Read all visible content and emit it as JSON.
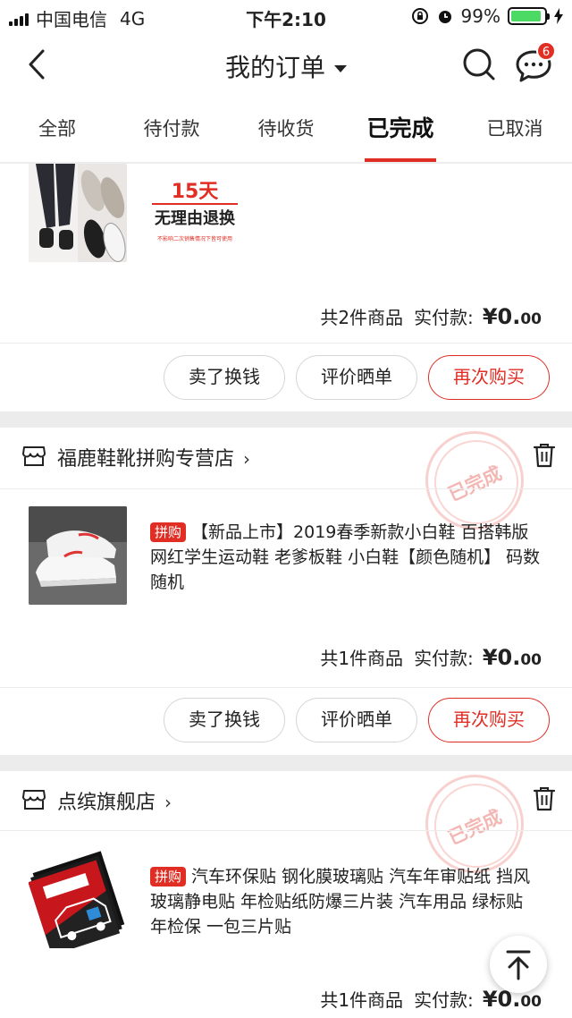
{
  "status_bar": {
    "carrier": "中国电信",
    "network": "4G",
    "time": "下午2:10",
    "battery": "99%"
  },
  "nav": {
    "title": "我的订单",
    "message_badge": "6"
  },
  "tabs": [
    {
      "label": "全部"
    },
    {
      "label": "待付款"
    },
    {
      "label": "待收货"
    },
    {
      "label": "已完成"
    },
    {
      "label": "已取消"
    }
  ],
  "orders": [
    {
      "promo_days": "15天",
      "promo_main": "无理由退换",
      "promo_small": "不影响二次销售情况下皆可使用",
      "count_text": "共2件商品",
      "pay_label": "实付款:",
      "price_int": "¥0.",
      "price_dec": "00",
      "buttons": [
        "卖了换钱",
        "评价晒单",
        "再次购买"
      ]
    },
    {
      "store": "福鹿鞋靴拼购专营店",
      "stamp": "已完成",
      "tag": "拼购",
      "title": "【新品上市】2019春季新款小白鞋 百搭韩版网红学生运动鞋 老爹板鞋 小白鞋【颜色随机】 码数随机",
      "count_text": "共1件商品",
      "pay_label": "实付款:",
      "price_int": "¥0.",
      "price_dec": "00",
      "buttons": [
        "卖了换钱",
        "评价晒单",
        "再次购买"
      ]
    },
    {
      "store": "点缤旗舰店",
      "stamp": "已完成",
      "tag": "拼购",
      "title": "汽车环保贴 钢化膜玻璃贴 汽车年审贴纸 挡风玻璃静电贴 年检贴纸防爆三片装 汽车用品 绿标贴 年检保 一包三片贴",
      "count_text": "共1件商品",
      "pay_label": "实付款:",
      "price_int": "¥0.",
      "price_dec": "00"
    }
  ],
  "colors": {
    "accent": "#e02e24",
    "background": "#ececec",
    "battery": "#4cd964"
  }
}
